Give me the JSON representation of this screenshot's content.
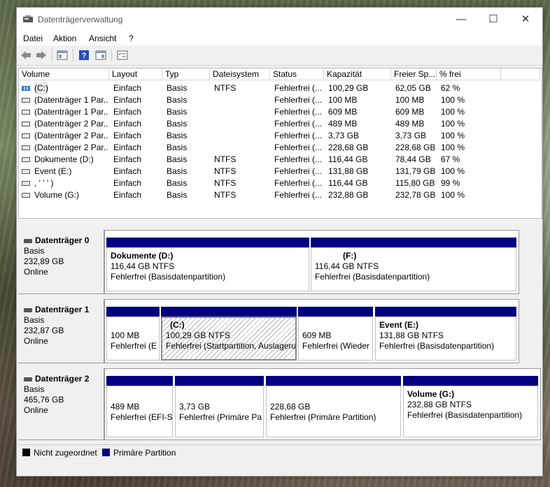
{
  "window": {
    "title": "Datenträgerverwaltung",
    "controls": {
      "minimize": "—",
      "maximize": "☐",
      "close": "✕"
    }
  },
  "menu": [
    "Datei",
    "Aktion",
    "Ansicht",
    "?"
  ],
  "table": {
    "headers": [
      "Volume",
      "Layout",
      "Typ",
      "Dateisystem",
      "Status",
      "Kapazität",
      "Freier Sp...",
      "% frei"
    ],
    "rows": [
      {
        "volume": "(C:)",
        "layout": "Einfach",
        "typ": "Basis",
        "fs": "NTFS",
        "status": "Fehlerfrei (...",
        "cap": "100,29 GB",
        "free": "62,05 GB",
        "pct": "62 %"
      },
      {
        "volume": "(Datenträger 1 Par...",
        "layout": "Einfach",
        "typ": "Basis",
        "fs": "",
        "status": "Fehlerfrei (...",
        "cap": "100 MB",
        "free": "100 MB",
        "pct": "100 %"
      },
      {
        "volume": "(Datenträger 1 Par...",
        "layout": "Einfach",
        "typ": "Basis",
        "fs": "",
        "status": "Fehlerfrei (...",
        "cap": "609 MB",
        "free": "609 MB",
        "pct": "100 %"
      },
      {
        "volume": "(Datenträger 2 Par...",
        "layout": "Einfach",
        "typ": "Basis",
        "fs": "",
        "status": "Fehlerfrei (...",
        "cap": "489 MB",
        "free": "489 MB",
        "pct": "100 %"
      },
      {
        "volume": "(Datenträger 2 Par...",
        "layout": "Einfach",
        "typ": "Basis",
        "fs": "",
        "status": "Fehlerfrei (...",
        "cap": "3,73 GB",
        "free": "3,73 GB",
        "pct": "100 %"
      },
      {
        "volume": "(Datenträger 2 Par...",
        "layout": "Einfach",
        "typ": "Basis",
        "fs": "",
        "status": "Fehlerfrei (...",
        "cap": "228,68 GB",
        "free": "228,68 GB",
        "pct": "100 %"
      },
      {
        "volume": "Dokumente (D:)",
        "layout": "Einfach",
        "typ": "Basis",
        "fs": "NTFS",
        "status": "Fehlerfrei (...",
        "cap": "116,44 GB",
        "free": "78,44 GB",
        "pct": "67 %"
      },
      {
        "volume": "Event (E:)",
        "layout": "Einfach",
        "typ": "Basis",
        "fs": "NTFS",
        "status": "Fehlerfrei (...",
        "cap": "131,88 GB",
        "free": "131,79 GB",
        "pct": "100 %"
      },
      {
        "volume": ", ' ' ' )",
        "layout": "Einfach",
        "typ": "Basis",
        "fs": "NTFS",
        "status": "Fehlerfrei (...",
        "cap": "116,44 GB",
        "free": "115,80 GB",
        "pct": "99 %"
      },
      {
        "volume": "Volume (G:)",
        "layout": "Einfach",
        "typ": "Basis",
        "fs": "NTFS",
        "status": "Fehlerfrei (...",
        "cap": "232,88 GB",
        "free": "232,78 GB",
        "pct": "100 %"
      }
    ]
  },
  "disks": [
    {
      "name": "Datenträger 0",
      "type": "Basis",
      "size": "232,89 GB",
      "state": "Online",
      "partitions": [
        {
          "name": "Dokumente  (D:)",
          "size": "116,44 GB NTFS",
          "status": "Fehlerfrei (Basisdatenpartition)"
        },
        {
          "name": "(F:)",
          "size": "116,44 GB NTFS",
          "status": "Fehlerfrei (Basisdatenpartition)"
        }
      ]
    },
    {
      "name": "Datenträger 1",
      "type": "Basis",
      "size": "232,87 GB",
      "state": "Online",
      "partitions": [
        {
          "name": "",
          "size": "100 MB",
          "status": "Fehlerfrei (E"
        },
        {
          "name": "(C:)",
          "size": "100,29 GB NTFS",
          "status": "Fehlerfrei (Startpartition, Auslageru"
        },
        {
          "name": "",
          "size": "609 MB",
          "status": "Fehlerfrei (Wieder"
        },
        {
          "name": "Event  (E:)",
          "size": "131,88 GB NTFS",
          "status": "Fehlerfrei (Basisdatenpartition)"
        }
      ]
    },
    {
      "name": "Datenträger 2",
      "type": "Basis",
      "size": "465,76 GB",
      "state": "Online",
      "partitions": [
        {
          "name": "",
          "size": "489 MB",
          "status": "Fehlerfrei (EFI-S"
        },
        {
          "name": "",
          "size": "3,73 GB",
          "status": "Fehlerfrei (Primäre Pa"
        },
        {
          "name": "",
          "size": "228,68 GB",
          "status": "Fehlerfrei (Primäre Partition)"
        },
        {
          "name": "Volume  (G:)",
          "size": "232,88 GB NTFS",
          "status": "Fehlerfrei (Basisdatenpartition)"
        }
      ]
    }
  ],
  "legend": {
    "unallocated": "Nicht zugeordnet",
    "primary": "Primäre Partition"
  },
  "colors": {
    "primary_partition": "#000080",
    "unallocated": "#000000",
    "system_volume_icon": "#2d8ad8"
  }
}
